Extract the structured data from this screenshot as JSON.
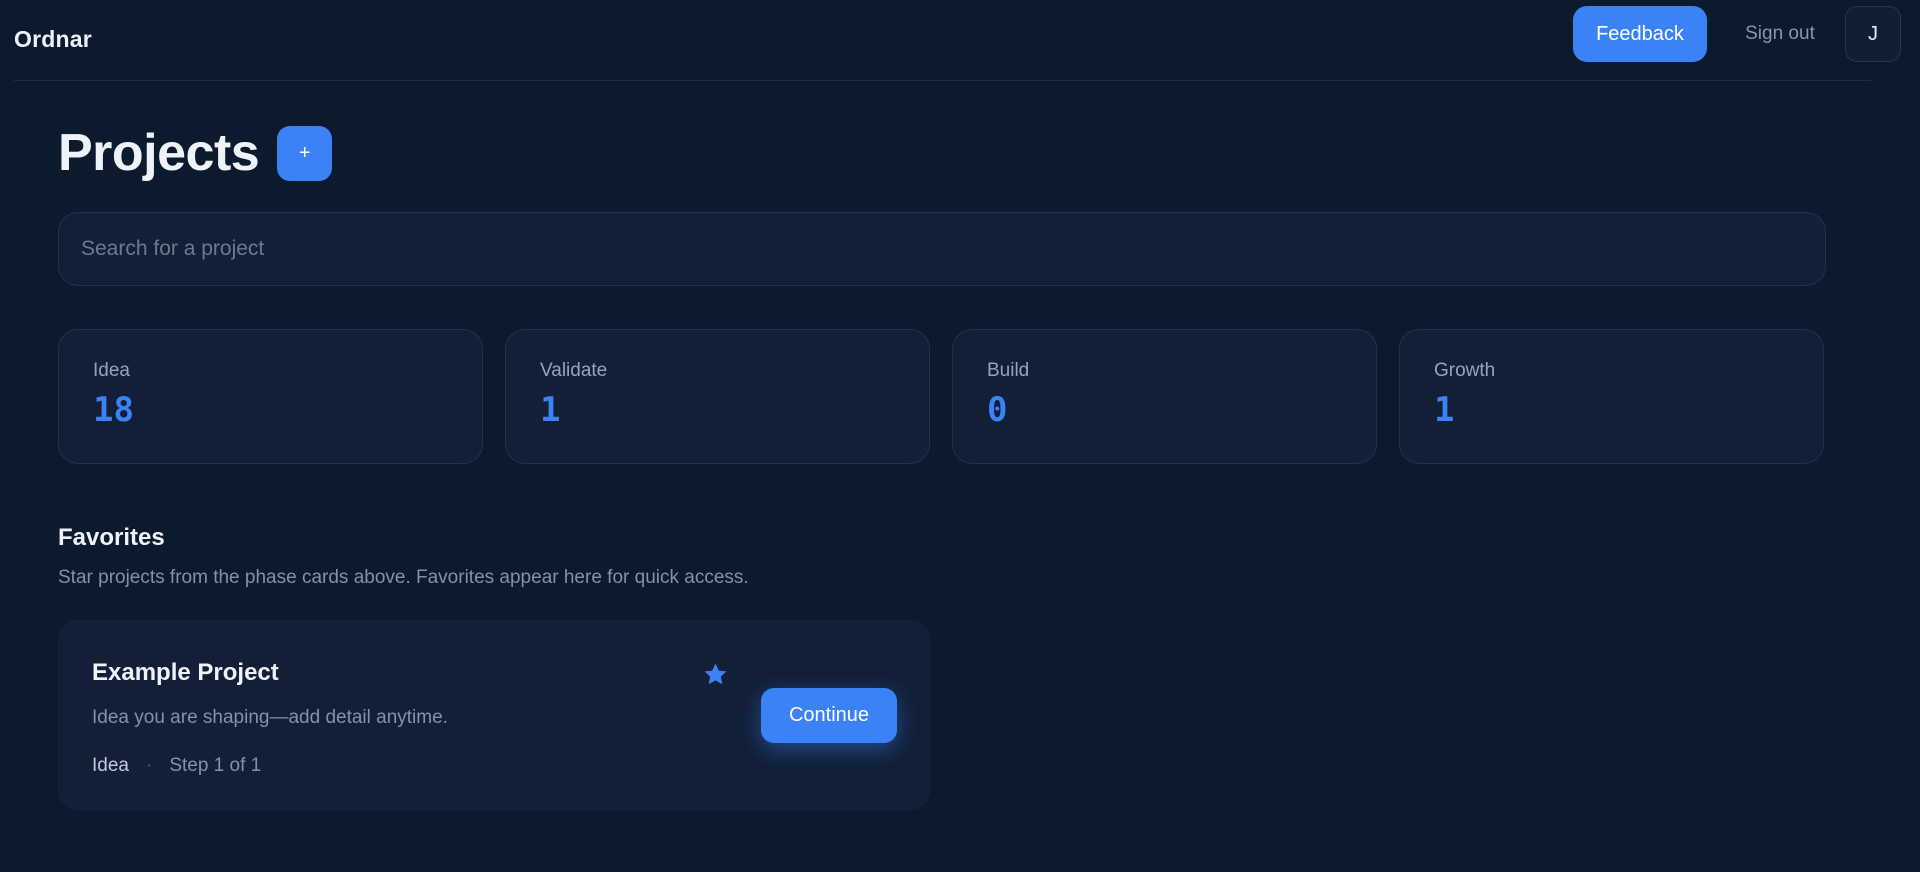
{
  "header": {
    "brand": "Ordnar",
    "feedback_label": "Feedback",
    "signout_label": "Sign out",
    "avatar_initial": "J"
  },
  "page": {
    "title": "Projects",
    "add_label": "+"
  },
  "search": {
    "placeholder": "Search for a project"
  },
  "stats": [
    {
      "label": "Idea",
      "value": "18"
    },
    {
      "label": "Validate",
      "value": "1"
    },
    {
      "label": "Build",
      "value": "0"
    },
    {
      "label": "Growth",
      "value": "1"
    }
  ],
  "favorites": {
    "title": "Favorites",
    "description": "Star projects from the phase cards above. Favorites appear here for quick access.",
    "items": [
      {
        "name": "Example Project",
        "description": "Idea you are shaping—add detail anytime.",
        "phase": "Idea",
        "separator": "·",
        "step": "Step 1 of 1",
        "continue_label": "Continue",
        "star_icon": "star-icon"
      }
    ]
  },
  "colors": {
    "background": "#0c1a2e",
    "card": "#121f37",
    "accent": "#3b82f6",
    "muted_text": "#8492a6"
  }
}
